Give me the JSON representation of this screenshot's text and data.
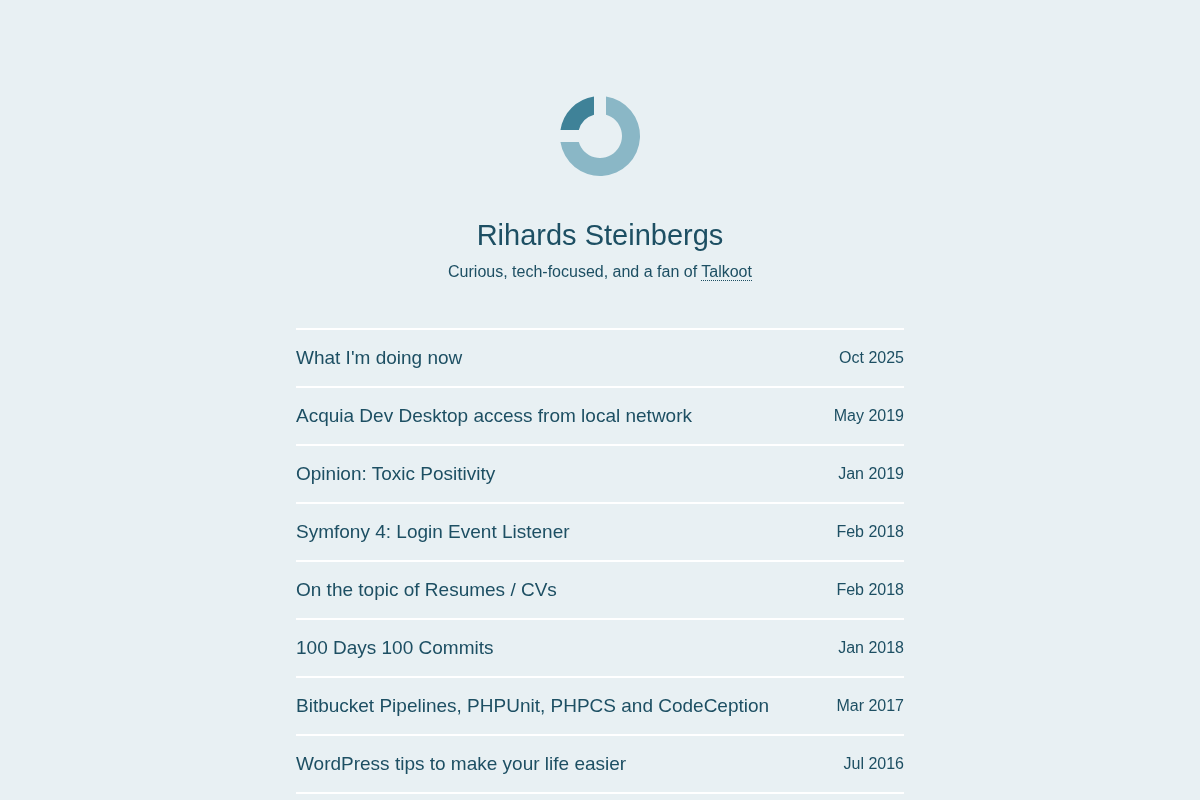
{
  "header": {
    "name": "Rihards Steinbergs",
    "tagline": {
      "text": "Curious, tech-focused, and a fan of",
      "link": "Talkoot"
    }
  },
  "posts": [
    {
      "title": "What I'm doing now",
      "date": "Oct 2025"
    },
    {
      "title": "Acquia Dev Desktop access from local network",
      "date": "May 2019"
    },
    {
      "title": "Opinion: Toxic Positivity",
      "date": "Jan 2019"
    },
    {
      "title": "Symfony 4: Login Event Listener",
      "date": "Feb 2018"
    },
    {
      "title": "On the topic of Resumes / CVs",
      "date": "Feb 2018"
    },
    {
      "title": "100 Days 100 Commits",
      "date": "Jan 2018"
    },
    {
      "title": "Bitbucket Pipelines, PHPUnit, PHPCS and CodeCeption",
      "date": "Mar 2017"
    },
    {
      "title": "WordPress tips to make your life easier",
      "date": "Jul 2016"
    }
  ]
}
